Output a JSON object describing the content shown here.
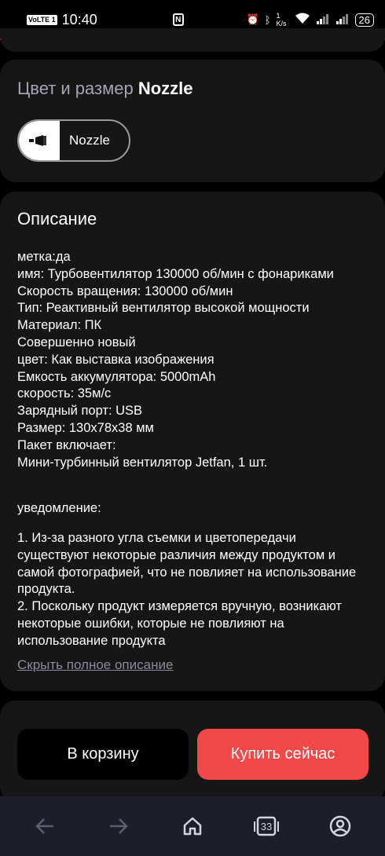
{
  "status_bar": {
    "network_badge": "VoLTE 1",
    "time": "10:40",
    "nfc": "N",
    "speed": "1 K/s",
    "battery": "26"
  },
  "variant": {
    "title_prefix": "Цвет и размер",
    "title_value": "Nozzle",
    "options": [
      {
        "label": "Nozzle",
        "selected": true
      }
    ]
  },
  "description": {
    "title": "Описание",
    "lines": [
      "метка:да",
      "имя: Турбовентилятор 130000 об/мин с фонариками",
      "Скорость вращения: 130000 об/мин",
      "Тип: Реактивный вентилятор высокой мощности",
      "Материал: ПК",
      "Совершенно новый",
      "цвет: Как выставка изображения",
      "Емкость аккумулятора: 5000mAh",
      "скорость: 35м/с",
      "Зарядный порт: USB",
      "Размер: 130x78x38 мм",
      "Пакет включает:",
      "Мини-турбинный вентилятор Jetfan, 1 шт."
    ],
    "notice_label": "уведомление:",
    "notice_lines": [
      "1. Из-за разного угла съемки и цветопередачи существуют некоторые различия между продуктом и самой фотографией, что не повлияет на использование продукта.",
      "2. Поскольку продукт измеряется вручную, возникают некоторые ошибки, которые не повлияют на использование продукта"
    ],
    "collapse_link": "Скрыть полное описание"
  },
  "actions": {
    "cart_label": "В корзину",
    "buy_label": "Купить сейчас"
  },
  "browser_nav": {
    "tabs_count": "33",
    "icons": [
      "back-arrow-icon",
      "forward-arrow-icon",
      "home-icon",
      "tabs-icon",
      "account-icon"
    ]
  },
  "colors": {
    "accent": "#f24848",
    "card_bg": "#161616",
    "nav_bg": "#1d1e2a",
    "muted_text": "#a7a4b7"
  }
}
